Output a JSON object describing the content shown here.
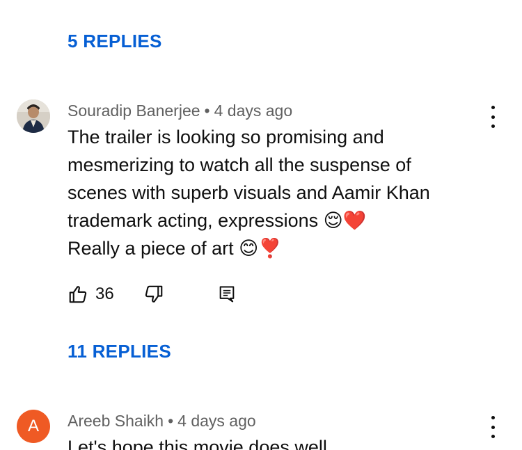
{
  "thread1": {
    "replies_label": "5 REPLIES"
  },
  "comment1": {
    "author": "Souradip Banerjee",
    "separator": "•",
    "time": "4 days ago",
    "lines": [
      "The trailer is looking so promising and",
      "mesmerizing to watch all the suspense of",
      "scenes with superb visuals and Aamir Khan",
      "trademark acting, expressions 😌❤️",
      "Really a piece of art 😊❣️"
    ],
    "like_count": "36",
    "replies_label": "11 REPLIES",
    "icons": [
      "thumbs-up-icon",
      "thumbs-down-icon",
      "reply-icon",
      "more-vert-icon"
    ]
  },
  "comment2": {
    "avatar_letter": "A",
    "avatar_color": "#ef5a24",
    "author": "Areeb Shaikh",
    "separator": "•",
    "time": "4 days ago",
    "text": "Let's hope this movie does well"
  },
  "colors": {
    "link": "#065fd4",
    "meta": "#606060",
    "text": "#0f0f0f"
  }
}
